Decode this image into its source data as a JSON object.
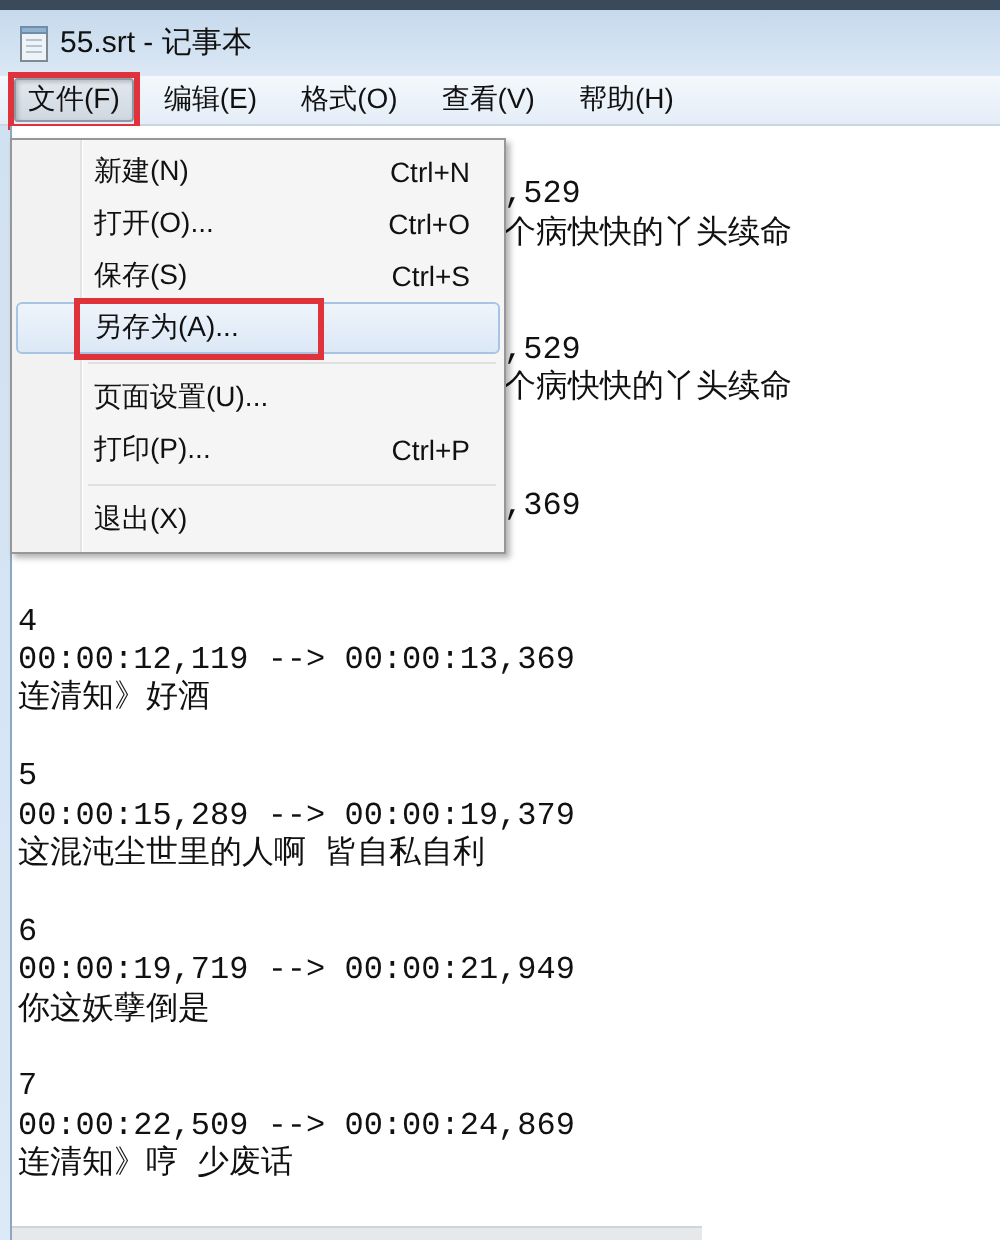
{
  "window": {
    "title": "55.srt - 记事本"
  },
  "menubar": [
    {
      "label": "文件(F)",
      "selected": true,
      "annotated": true
    },
    {
      "label": "编辑(E)",
      "selected": false,
      "annotated": false
    },
    {
      "label": "格式(O)",
      "selected": false,
      "annotated": false
    },
    {
      "label": "查看(V)",
      "selected": false,
      "annotated": false
    },
    {
      "label": "帮助(H)",
      "selected": false,
      "annotated": false
    }
  ],
  "file_menu": [
    {
      "kind": "item",
      "label": "新建(N)",
      "shortcut": "Ctrl+N",
      "selected": false,
      "annotated": false
    },
    {
      "kind": "item",
      "label": "打开(O)...",
      "shortcut": "Ctrl+O",
      "selected": false,
      "annotated": false
    },
    {
      "kind": "item",
      "label": "保存(S)",
      "shortcut": "Ctrl+S",
      "selected": false,
      "annotated": false
    },
    {
      "kind": "item",
      "label": "另存为(A)...",
      "selected": true,
      "annotated": true
    },
    {
      "kind": "separator"
    },
    {
      "kind": "item",
      "label": "页面设置(U)...",
      "selected": false,
      "annotated": false
    },
    {
      "kind": "item",
      "label": "打印(P)...",
      "shortcut": "Ctrl+P",
      "selected": false,
      "annotated": false
    },
    {
      "kind": "separator"
    },
    {
      "kind": "item",
      "label": "退出(X)",
      "selected": false,
      "annotated": false
    }
  ],
  "editor_lines": [
    {
      "kind": "blank"
    },
    {
      "kind": "clipped",
      "text": ",529"
    },
    {
      "kind": "clipped",
      "text": "个病快快的丫头续命"
    },
    {
      "kind": "blank"
    },
    {
      "kind": "blank"
    },
    {
      "kind": "clipped",
      "text": ",529"
    },
    {
      "kind": "clipped",
      "text": "个病快快的丫头续命"
    },
    {
      "kind": "blank"
    },
    {
      "kind": "blank"
    },
    {
      "kind": "clipped",
      "text": ",369"
    },
    {
      "kind": "blank"
    },
    {
      "kind": "blank"
    },
    {
      "kind": "full",
      "text": "4"
    },
    {
      "kind": "full",
      "text": "00:00:12,119 --> 00:00:13,369"
    },
    {
      "kind": "full",
      "text": "连清知》好酒"
    },
    {
      "kind": "blank"
    },
    {
      "kind": "full",
      "text": "5"
    },
    {
      "kind": "full",
      "text": "00:00:15,289 --> 00:00:19,379"
    },
    {
      "kind": "full",
      "text": "这混沌尘世里的人啊 皆自私自利"
    },
    {
      "kind": "blank"
    },
    {
      "kind": "full",
      "text": "6"
    },
    {
      "kind": "full",
      "text": "00:00:19,719 --> 00:00:21,949"
    },
    {
      "kind": "full",
      "text": "你这妖孽倒是"
    },
    {
      "kind": "blank"
    },
    {
      "kind": "full",
      "text": "7"
    },
    {
      "kind": "full",
      "text": "00:00:22,509 --> 00:00:24,869"
    },
    {
      "kind": "full",
      "text": "连清知》哼 少废话"
    }
  ]
}
